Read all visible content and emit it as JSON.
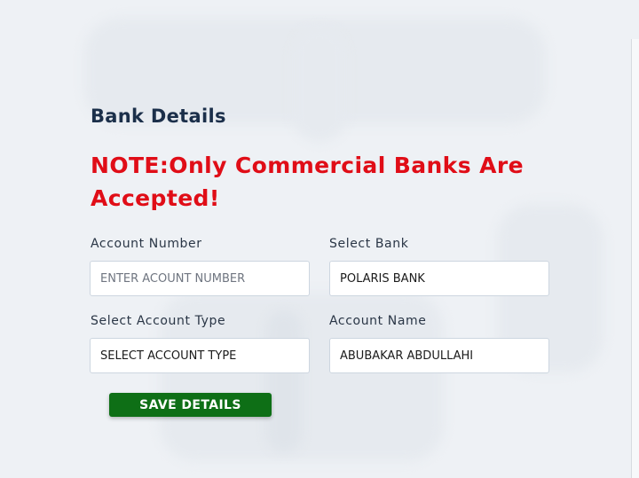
{
  "form": {
    "heading": "Bank Details",
    "note": "NOTE:Only Commercial Banks Are Accepted!",
    "account_number": {
      "label": "Account Number",
      "placeholder": "ENTER ACOUNT NUMBER",
      "value": ""
    },
    "bank": {
      "label": "Select Bank",
      "value": "POLARIS BANK"
    },
    "account_type": {
      "label": "Select Account Type",
      "value": "SELECT ACCOUNT TYPE"
    },
    "account_name": {
      "label": "Account Name",
      "value": "ABUBAKAR ABDULLAHI"
    },
    "save_label": "SAVE DETAILS"
  },
  "colors": {
    "note_red": "#e00d17",
    "heading_navy": "#1b2f4a",
    "button_green": "#0e6f16",
    "background": "#eef1f5"
  }
}
